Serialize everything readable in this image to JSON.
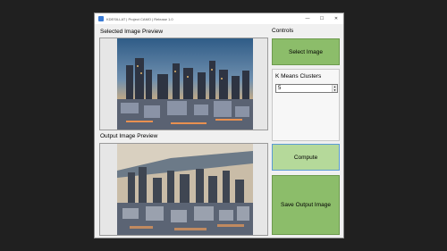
{
  "window": {
    "title": "KDESILLAT | Project CAMO | Release 1.0",
    "minimize_glyph": "—",
    "maximize_glyph": "☐",
    "close_glyph": "✕"
  },
  "left": {
    "selected_label": "Selected Image Preview",
    "output_label": "Output Image Preview"
  },
  "controls": {
    "heading": "Controls",
    "select_label": "Select Image",
    "k_label": "K Means Clusters",
    "k_value": "5",
    "compute_label": "Compute",
    "save_label": "Save Output Image"
  },
  "colors": {
    "button_green": "#8cbd6a",
    "compute_green": "#b5d99a",
    "focus_blue": "#5b9bd5"
  }
}
